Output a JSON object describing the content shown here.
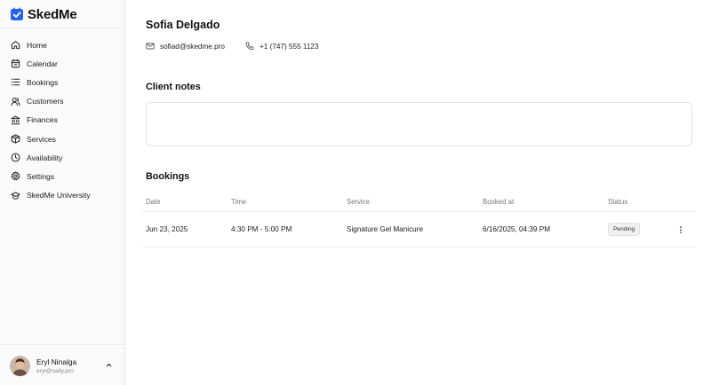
{
  "brand": {
    "name": "SkedMe",
    "accent": "#2563eb"
  },
  "sidebar": {
    "items": [
      {
        "label": "Home",
        "icon": "home-icon"
      },
      {
        "label": "Calendar",
        "icon": "calendar-icon"
      },
      {
        "label": "Bookings",
        "icon": "list-icon"
      },
      {
        "label": "Customers",
        "icon": "users-icon"
      },
      {
        "label": "Finances",
        "icon": "bank-icon"
      },
      {
        "label": "Services",
        "icon": "box-icon"
      },
      {
        "label": "Availability",
        "icon": "clock-icon"
      },
      {
        "label": "Settings",
        "icon": "gear-icon"
      },
      {
        "label": "SkedMe University",
        "icon": "graduation-cap-icon"
      }
    ]
  },
  "user": {
    "name": "Eryl Ninalga",
    "email": "eryl@naily.pro"
  },
  "client": {
    "name": "Sofia Delgado",
    "email": "sofiad@skedme.pro",
    "phone": "+1 (747) 555 1123"
  },
  "notes": {
    "title": "Client notes",
    "value": ""
  },
  "bookings": {
    "title": "Bookings",
    "columns": {
      "date": "Date",
      "time": "Time",
      "service": "Service",
      "booked_at": "Booked at",
      "status": "Status"
    },
    "rows": [
      {
        "date": "Jun 23, 2025",
        "time": "4:30 PM - 5:00 PM",
        "service": "Signature Gel Manicure",
        "booked_at": "6/16/2025, 04:39 PM",
        "status": "Pending"
      }
    ]
  }
}
